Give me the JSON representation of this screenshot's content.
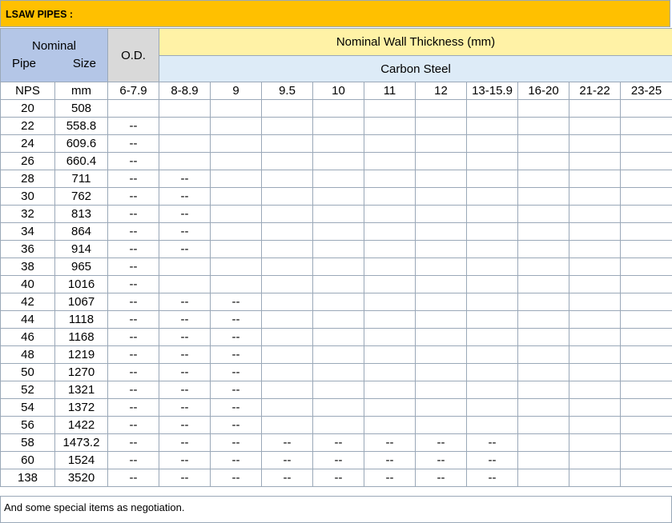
{
  "banner_title": "LSAW PIPES :",
  "header": {
    "nominal_line1": "Nominal",
    "nominal_pipe": "Pipe",
    "nominal_size": "Size",
    "od": "O.D.",
    "wall_thickness": "Nominal Wall Thickness (mm)",
    "material": "Carbon Steel",
    "nps": "NPS",
    "mm": "mm",
    "thickness_ranges": [
      "6-7.9",
      "8-8.9",
      "9",
      "9.5",
      "10",
      "11",
      "12",
      "13-15.9",
      "16-20",
      "21-22",
      "23-25"
    ]
  },
  "rows": [
    {
      "nps": "20",
      "mm": "508",
      "cells": [
        "",
        "",
        "",
        "",
        "",
        "",
        "",
        "",
        "",
        "",
        ""
      ]
    },
    {
      "nps": "22",
      "mm": "558.8",
      "cells": [
        "--",
        "",
        "",
        "",
        "",
        "",
        "",
        "",
        "",
        "",
        ""
      ]
    },
    {
      "nps": "24",
      "mm": "609.6",
      "cells": [
        "--",
        "",
        "",
        "",
        "",
        "",
        "",
        "",
        "",
        "",
        ""
      ]
    },
    {
      "nps": "26",
      "mm": "660.4",
      "cells": [
        "--",
        "",
        "",
        "",
        "",
        "",
        "",
        "",
        "",
        "",
        ""
      ]
    },
    {
      "nps": "28",
      "mm": "711",
      "cells": [
        "--",
        "--",
        "",
        "",
        "",
        "",
        "",
        "",
        "",
        "",
        ""
      ]
    },
    {
      "nps": "30",
      "mm": "762",
      "cells": [
        "--",
        "--",
        "",
        "",
        "",
        "",
        "",
        "",
        "",
        "",
        ""
      ]
    },
    {
      "nps": "32",
      "mm": "813",
      "cells": [
        "--",
        "--",
        "",
        "",
        "",
        "",
        "",
        "",
        "",
        "",
        ""
      ]
    },
    {
      "nps": "34",
      "mm": "864",
      "cells": [
        "--",
        "--",
        "",
        "",
        "",
        "",
        "",
        "",
        "",
        "",
        ""
      ]
    },
    {
      "nps": "36",
      "mm": "914",
      "cells": [
        "--",
        "--",
        "",
        "",
        "",
        "",
        "",
        "",
        "",
        "",
        ""
      ]
    },
    {
      "nps": "38",
      "mm": "965",
      "cells": [
        "--",
        "",
        "",
        "",
        "",
        "",
        "",
        "",
        "",
        "",
        ""
      ]
    },
    {
      "nps": "40",
      "mm": "1016",
      "cells": [
        "--",
        "",
        "",
        "",
        "",
        "",
        "",
        "",
        "",
        "",
        ""
      ]
    },
    {
      "nps": "42",
      "mm": "1067",
      "cells": [
        "--",
        "--",
        "--",
        "",
        "",
        "",
        "",
        "",
        "",
        "",
        ""
      ]
    },
    {
      "nps": "44",
      "mm": "1118",
      "cells": [
        "--",
        "--",
        "--",
        "",
        "",
        "",
        "",
        "",
        "",
        "",
        ""
      ]
    },
    {
      "nps": "46",
      "mm": "1168",
      "cells": [
        "--",
        "--",
        "--",
        "",
        "",
        "",
        "",
        "",
        "",
        "",
        ""
      ]
    },
    {
      "nps": "48",
      "mm": "1219",
      "cells": [
        "--",
        "--",
        "--",
        "",
        "",
        "",
        "",
        "",
        "",
        "",
        ""
      ]
    },
    {
      "nps": "50",
      "mm": "1270",
      "cells": [
        "--",
        "--",
        "--",
        "",
        "",
        "",
        "",
        "",
        "",
        "",
        ""
      ]
    },
    {
      "nps": "52",
      "mm": "1321",
      "cells": [
        "--",
        "--",
        "--",
        "",
        "",
        "",
        "",
        "",
        "",
        "",
        ""
      ]
    },
    {
      "nps": "54",
      "mm": "1372",
      "cells": [
        "--",
        "--",
        "--",
        "",
        "",
        "",
        "",
        "",
        "",
        "",
        ""
      ]
    },
    {
      "nps": "56",
      "mm": "1422",
      "cells": [
        "--",
        "--",
        "--",
        "",
        "",
        "",
        "",
        "",
        "",
        "",
        ""
      ]
    },
    {
      "nps": "58",
      "mm": "1473.2",
      "cells": [
        "--",
        "--",
        "--",
        "--",
        "--",
        "--",
        "--",
        "--",
        "",
        "",
        ""
      ]
    },
    {
      "nps": "60",
      "mm": "1524",
      "cells": [
        "--",
        "--",
        "--",
        "--",
        "--",
        "--",
        "--",
        "--",
        "",
        "",
        ""
      ]
    },
    {
      "nps": "138",
      "mm": "3520",
      "cells": [
        "--",
        "--",
        "--",
        "--",
        "--",
        "--",
        "--",
        "--",
        "",
        "",
        ""
      ]
    }
  ],
  "footer_note": "And some special items as negotiation."
}
